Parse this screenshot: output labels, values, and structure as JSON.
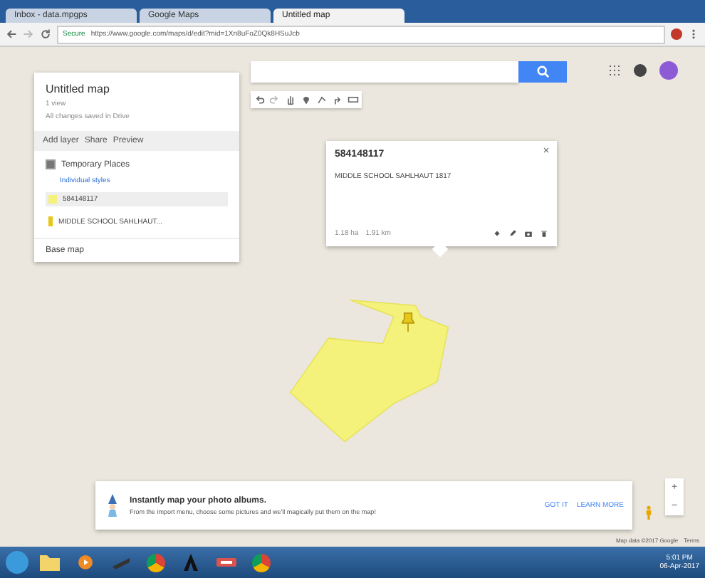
{
  "browser": {
    "tabs": [
      {
        "label": "Inbox - data.mpgps",
        "selected": false
      },
      {
        "label": "Google Maps",
        "selected": false
      },
      {
        "label": "Untitled map",
        "selected": true
      }
    ],
    "secure_label": "Secure",
    "url": "https://www.google.com/maps/d/edit?mid=1Xn8uFoZ0Qk8HSuJcb"
  },
  "map_panel": {
    "title": "Untitled map",
    "views": "1 view",
    "save_status": "All changes saved in Drive",
    "actions": [
      "Add layer",
      "Share",
      "Preview"
    ],
    "layer": {
      "name": "Temporary Places",
      "checked": true,
      "style": "Individual styles",
      "items": [
        {
          "label": "584148117",
          "kind": "polygon",
          "selected": true
        },
        {
          "label": "MIDDLE SCHOOL SAHLHAUT...",
          "kind": "marker",
          "selected": false
        }
      ]
    },
    "base_map": "Base map"
  },
  "info_window": {
    "title": "584148117",
    "description": "MIDDLE SCHOOL SAHLHAUT 1817",
    "area": "1.18 ha",
    "perimeter": "1.91 km"
  },
  "banner": {
    "title": "Instantly map your photo albums.",
    "text": "From the import menu, choose some pictures and we'll magically put them on the map!",
    "buttons": [
      "GOT IT",
      "LEARN MORE"
    ]
  },
  "attribution": {
    "map_data": "Map data ©2017 Google",
    "terms": "Terms"
  },
  "zoom_controls": [
    "+",
    "−"
  ],
  "taskbar": {
    "time": "5:01 PM",
    "date": "06-Apr-2017"
  }
}
